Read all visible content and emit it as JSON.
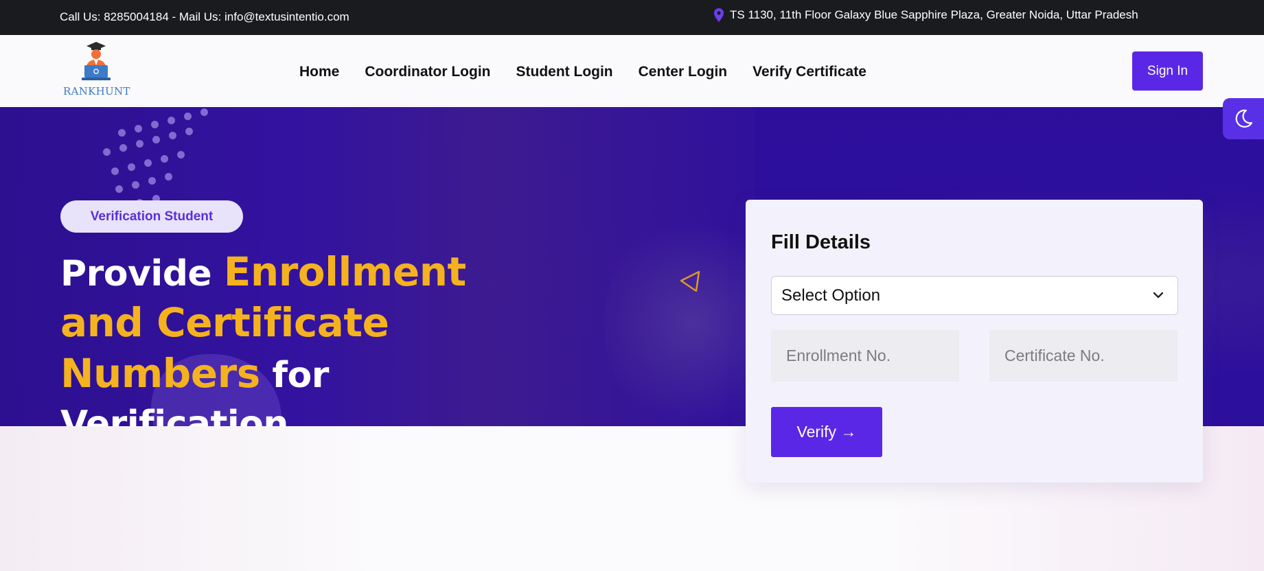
{
  "topbar": {
    "contact": "Call Us: 8285004184 - Mail Us: info@textusintentio.com",
    "address": "TS 1130, 11th Floor Galaxy Blue Sapphire Plaza, Greater Noida, Uttar Pradesh",
    "address_icon": "map-pin-icon"
  },
  "header": {
    "logo_text": "RANKHUNT",
    "nav": [
      "Home",
      "Coordinator Login",
      "Student Login",
      "Center Login",
      "Verify Certificate"
    ],
    "signin_label": "Sign In",
    "theme_toggle_icon": "moon-icon"
  },
  "hero": {
    "badge": "Verification Student",
    "headline_part1": "Provide ",
    "headline_highlight": "Enrollment and Certificate Numbers",
    "headline_part2": " for Verification"
  },
  "form": {
    "title": "Fill Details",
    "select_value": "Select Option",
    "enrollment_placeholder": "Enrollment No.",
    "certificate_placeholder": "Certificate No.",
    "verify_label": "Verify →"
  },
  "colors": {
    "primary": "#5b27e6",
    "hero_bg": "#2b0e9a",
    "highlight": "#f5b21f",
    "topbar_bg": "#1a1b1f"
  }
}
